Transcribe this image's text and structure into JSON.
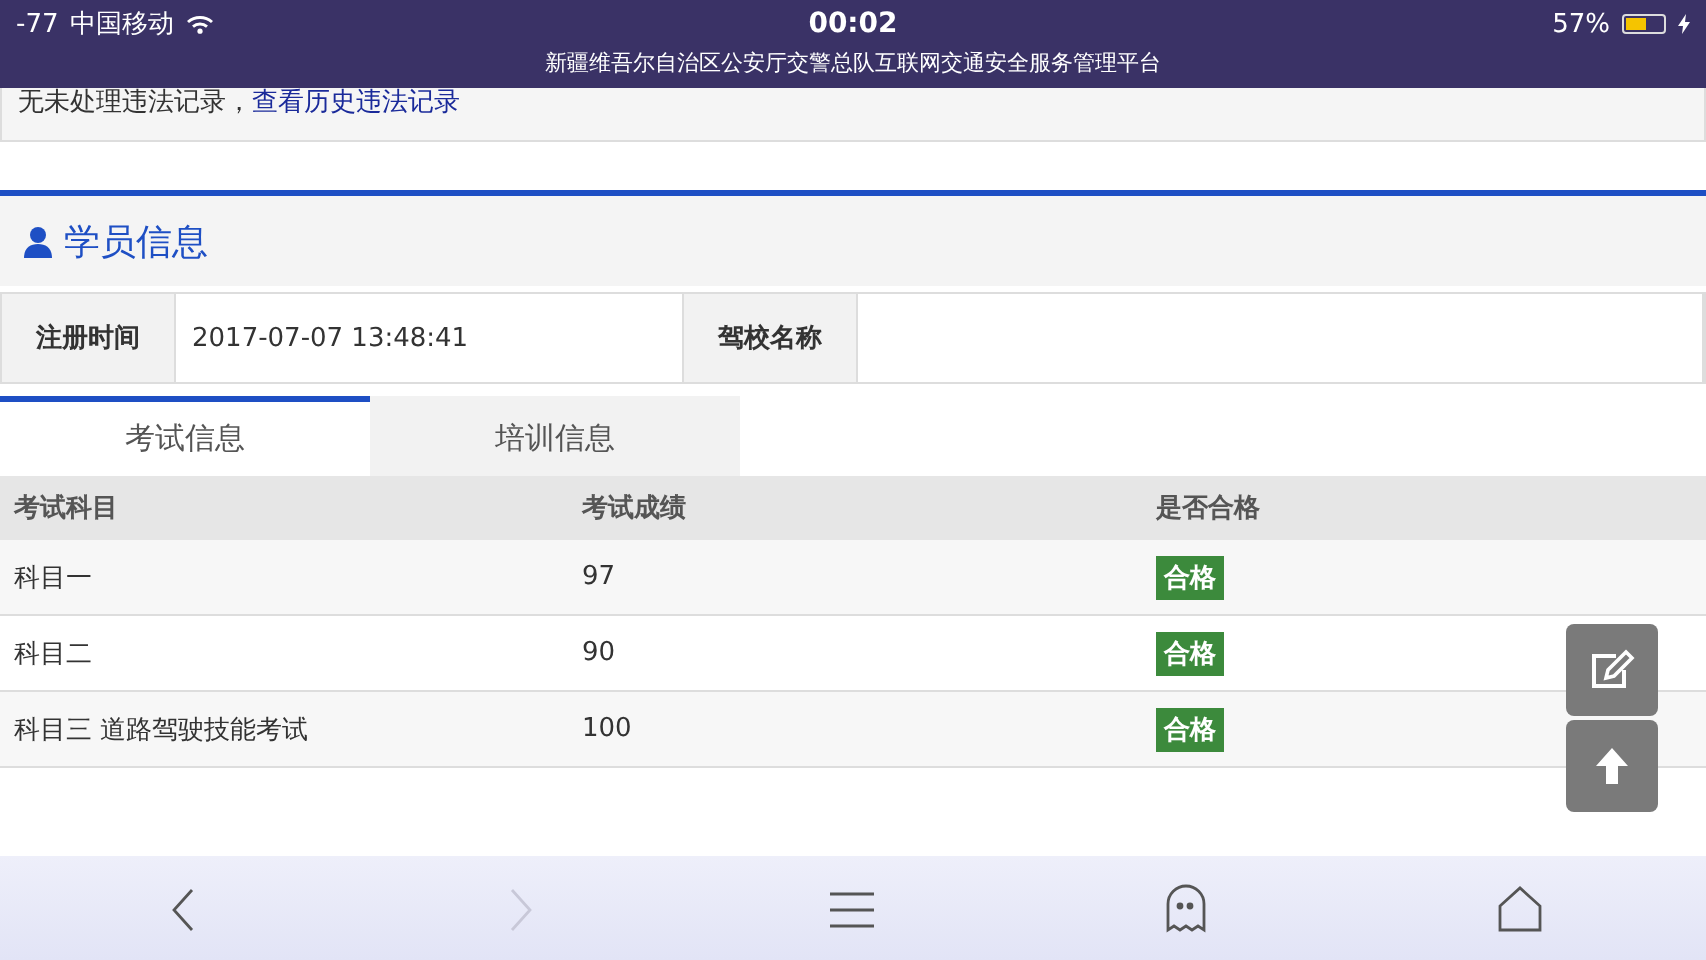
{
  "status_bar": {
    "signal": "-77",
    "carrier": "中国移动",
    "time": "00:02",
    "battery": "57%",
    "site_title": "新疆维吾尔自治区公安厅交警总队互联网交通安全服务管理平台"
  },
  "notice": {
    "text": "无未处理违法记录，",
    "link": "查看历史违法记录"
  },
  "section": {
    "title": "学员信息"
  },
  "info": [
    {
      "label": "注册时间",
      "value": "2017-07-07 13:48:41"
    },
    {
      "label": "驾校名称"
    }
  ],
  "tabs": [
    {
      "label": "考试信息",
      "selected": true
    },
    {
      "label": "培训信息",
      "selected": false
    }
  ],
  "table": {
    "columns": [
      "考试科目",
      "考试成绩",
      "是否合格"
    ],
    "rows": [
      {
        "subject": "科目一",
        "score": "97",
        "result": "合格"
      },
      {
        "subject": "科目二",
        "score": "90",
        "result": "合格"
      },
      {
        "subject": "科目三 道路驾驶技能考试",
        "score": "100",
        "result": "合格"
      }
    ]
  },
  "toolbar": [
    {
      "kind": "back",
      "disabled": false
    },
    {
      "kind": "forward",
      "disabled": true
    },
    {
      "kind": "menu",
      "disabled": false
    },
    {
      "kind": "ghost",
      "disabled": false
    },
    {
      "kind": "home",
      "disabled": false
    }
  ]
}
